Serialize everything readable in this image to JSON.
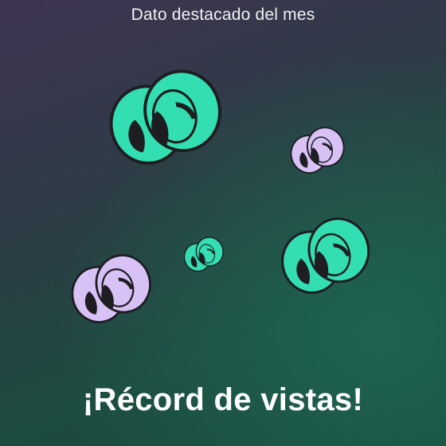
{
  "header": {
    "label": "Dato destacado del mes"
  },
  "headline": {
    "text": "¡Récord de vistas!"
  },
  "palette": {
    "teal": "#33dfb2",
    "lavender": "#d8c2f5",
    "outline": "#1d1d22",
    "pupil": "#1d1d22",
    "background_top": "#3f3452",
    "background_bottom": "#17483d"
  },
  "illustration": {
    "items": [
      {
        "name": "googly-eyes-large-teal",
        "color": "teal"
      },
      {
        "name": "googly-eyes-small-lavender",
        "color": "lavender"
      },
      {
        "name": "googly-eyes-tiny-teal",
        "color": "teal"
      },
      {
        "name": "googly-eyes-medium-teal",
        "color": "teal"
      },
      {
        "name": "googly-eyes-medium-lavender",
        "color": "lavender"
      }
    ]
  }
}
